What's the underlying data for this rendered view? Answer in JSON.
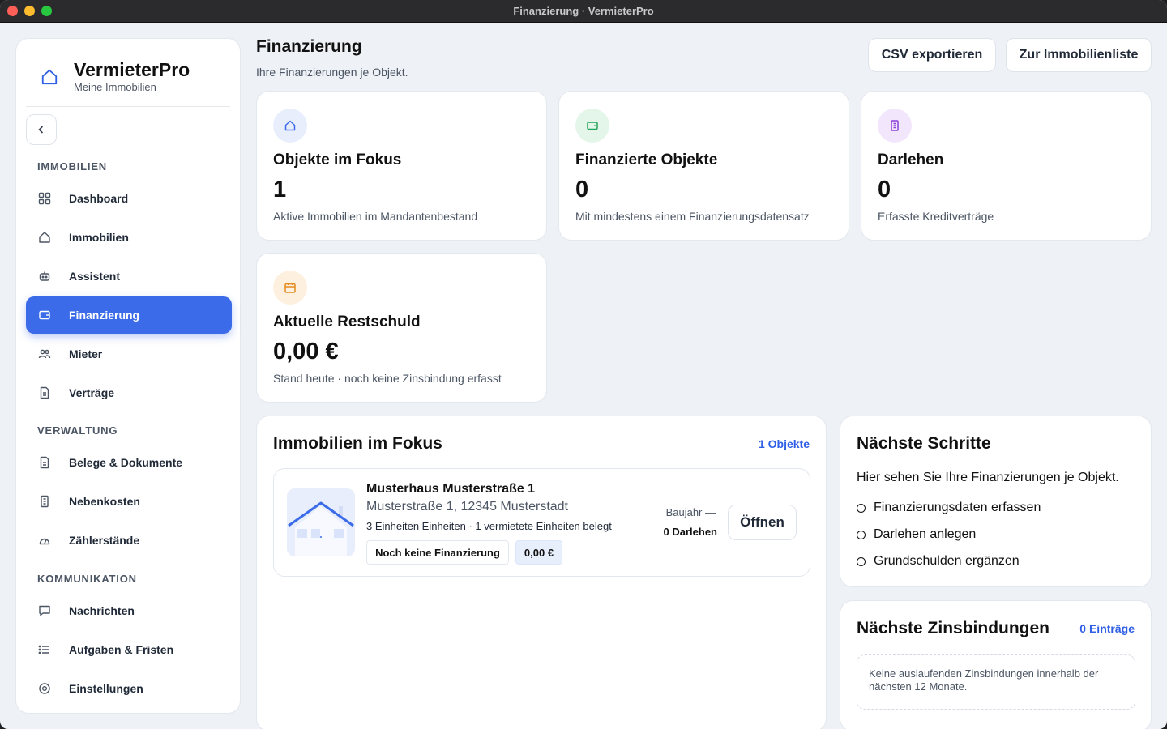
{
  "window": {
    "title": "Finanzierung · VermieterPro"
  },
  "brand": {
    "name": "VermieterPro",
    "subtitle": "Meine Immobilien"
  },
  "sidebar": {
    "sections": [
      {
        "label": "IMMOBILIEN",
        "items": [
          {
            "label": "Dashboard",
            "icon": "grid-icon"
          },
          {
            "label": "Immobilien",
            "icon": "home-icon"
          },
          {
            "label": "Assistent",
            "icon": "robot-icon"
          },
          {
            "label": "Finanzierung",
            "icon": "wallet-icon",
            "active": true
          },
          {
            "label": "Mieter",
            "icon": "users-icon"
          },
          {
            "label": "Verträge",
            "icon": "document-icon"
          }
        ]
      },
      {
        "label": "VERWALTUNG",
        "items": [
          {
            "label": "Belege & Dokumente",
            "icon": "file-icon"
          },
          {
            "label": "Nebenkosten",
            "icon": "receipt-icon"
          },
          {
            "label": "Zählerstände",
            "icon": "gauge-icon"
          }
        ]
      },
      {
        "label": "KOMMUNIKATION",
        "items": [
          {
            "label": "Nachrichten",
            "icon": "message-icon"
          },
          {
            "label": "Aufgaben & Fristen",
            "icon": "list-icon"
          },
          {
            "label": "Einstellungen",
            "icon": "settings-icon"
          }
        ]
      }
    ]
  },
  "header": {
    "title": "Finanzierung",
    "subtitle": "Ihre Finanzierungen je Objekt.",
    "export_label": "CSV exportieren",
    "list_label": "Zur Immobilienliste"
  },
  "stats": [
    {
      "title": "Objekte im Fokus",
      "value": "1",
      "desc": "Aktive Immobilien im Mandantenbestand",
      "icon": "home-icon",
      "color": "#3b6be8",
      "bg": "#e8eefc"
    },
    {
      "title": "Finanzierte Objekte",
      "value": "0",
      "desc": "Mit mindestens einem Finanzierungsdatensatz",
      "icon": "wallet-icon",
      "color": "#22a35a",
      "bg": "#e4f6ea"
    },
    {
      "title": "Darlehen",
      "value": "0",
      "desc": "Erfasste Kreditverträge",
      "icon": "receipt-icon",
      "color": "#8b3fd9",
      "bg": "#f1e6fb"
    },
    {
      "title": "Aktuelle Restschuld",
      "value": "0,00 €",
      "desc": "Stand heute · noch keine Zinsbindung erfasst",
      "icon": "calendar-icon",
      "color": "#e58a1f",
      "bg": "#fdf0df"
    }
  ],
  "focus": {
    "title": "Immobilien im Fokus",
    "count_label": "1 Objekte",
    "property": {
      "name": "Musterhaus Musterstraße 1",
      "address": "Musterstraße 1, 12345 Musterstadt",
      "units": "3 Einheiten Einheiten · 1 vermietete Einheiten belegt",
      "status_tag": "Noch keine Finanzierung",
      "amount_tag": "0,00 €",
      "baujahr": "Baujahr —",
      "loans": "0 Darlehen",
      "open_label": "Öffnen"
    }
  },
  "next_steps": {
    "title": "Nächste Schritte",
    "intro": "Hier sehen Sie Ihre Finanzierungen je Objekt.",
    "items": [
      "Finanzierungsdaten erfassen",
      "Darlehen anlegen",
      "Grundschulden ergänzen"
    ]
  },
  "rate_locks": {
    "title": "Nächste Zinsbindungen",
    "count_label": "0 Einträge",
    "empty_text": "Keine auslaufenden Zinsbindungen innerhalb der nächsten 12 Monate."
  }
}
